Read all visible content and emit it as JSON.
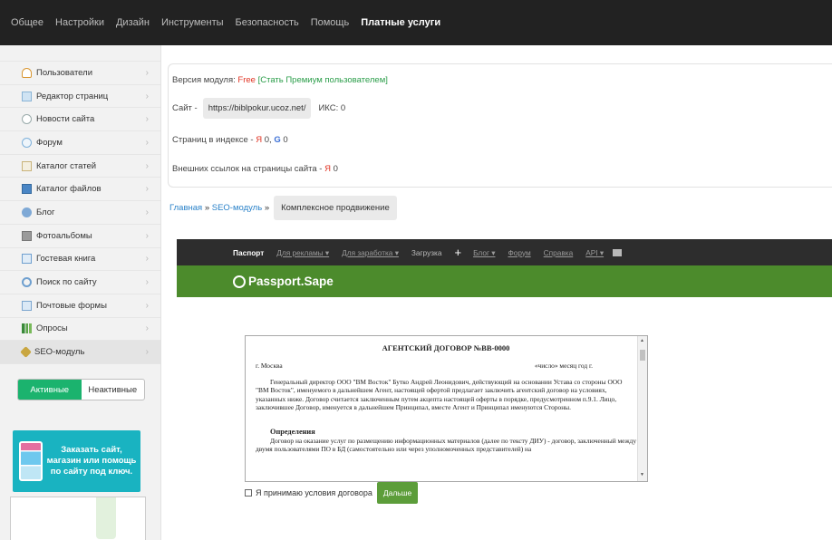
{
  "topnav": [
    {
      "label": "Общее",
      "active": false
    },
    {
      "label": "Настройки",
      "active": false
    },
    {
      "label": "Дизайн",
      "active": false
    },
    {
      "label": "Инструменты",
      "active": false
    },
    {
      "label": "Безопасность",
      "active": false
    },
    {
      "label": "Помощь",
      "active": false
    },
    {
      "label": "Платные услуги",
      "active": true
    }
  ],
  "sidebar": {
    "items": [
      {
        "label": "Пользователи",
        "icon": "user-icon"
      },
      {
        "label": "Редактор страниц",
        "icon": "page-icon"
      },
      {
        "label": "Новости сайта",
        "icon": "news-icon"
      },
      {
        "label": "Форум",
        "icon": "forum-icon"
      },
      {
        "label": "Каталог статей",
        "icon": "catalog-icon"
      },
      {
        "label": "Каталог файлов",
        "icon": "file-icon"
      },
      {
        "label": "Блог",
        "icon": "blog-icon"
      },
      {
        "label": "Фотоальбомы",
        "icon": "photo-icon"
      },
      {
        "label": "Гостевая книга",
        "icon": "guestbook-icon"
      },
      {
        "label": "Поиск по сайту",
        "icon": "search-icon"
      },
      {
        "label": "Почтовые формы",
        "icon": "mail-icon"
      },
      {
        "label": "Опросы",
        "icon": "poll-icon"
      },
      {
        "label": "SEO-модуль",
        "icon": "seo-icon"
      }
    ],
    "chevron": "›",
    "toggle": {
      "active": "Активные",
      "inactive": "Неактивные"
    },
    "promo": "Заказать сайт, магазин или помощь по сайту под ключ."
  },
  "info": {
    "version_label": "Версия модуля:",
    "version_value": "Free",
    "premium_link": "[Стать Премиум пользователем]",
    "site_label": "Сайт -",
    "site_url": "https://biblpokur.ucoz.net/",
    "iks": "ИКС: 0",
    "pages_label": "Страниц в индексе -",
    "yandex_letter": "Я",
    "yandex_pages": "0,",
    "google_letter": "G",
    "google_pages": "0",
    "links_label": "Внешних ссылок на страницы сайта -",
    "links_letter": "Я",
    "links_value": "0"
  },
  "breadcrumb": {
    "home": "Главная",
    "sep1": "»",
    "seo": "SEO-модуль",
    "sep2": "»",
    "current": "Комплексное продвижение"
  },
  "passport": {
    "nav": [
      {
        "label": "Паспорт",
        "type": "active"
      },
      {
        "label": "Для рекламы ▾",
        "type": "link"
      },
      {
        "label": "Для заработка ▾",
        "type": "link"
      },
      {
        "label": "Загрузка",
        "type": "plain"
      },
      {
        "label": "+",
        "type": "plus"
      },
      {
        "label": "Блог ▾",
        "type": "link"
      },
      {
        "label": "Форум",
        "type": "link"
      },
      {
        "label": "Справка",
        "type": "link"
      },
      {
        "label": "API ▾",
        "type": "link"
      }
    ],
    "logo": "Passport.Sape"
  },
  "document": {
    "title": "АГЕНТСКИЙ ДОГОВОР №ВВ-0000",
    "city": "г. Москва",
    "date": "«число» месяц год г.",
    "paragraph": "Генеральный директор ООО \"ВМ Восток\" Бутко Андрей Леонидович, действующий на основании Устава со стороны ООО \"ВМ Восток\", именуемого в дальнейшем Агент, настоящей офертой предлагает заключить агентский договор на условиях, указанных ниже. Договор считается заключенным путем акцепта настоящей оферты в порядке, предусмотренном п.9.1. Лицо, заключившее Договор, именуется в дальнейшем Принципал, вместе Агент и Принципал именуются Стороны.",
    "section": "Определения",
    "section_text": "Договор на оказание услуг по размещению информационных материалов (далее по тексту ДИУ) - договор, заключенный между двумя пользователями ПО в БД (самостоятельно или через уполномоченных представителей) на"
  },
  "accept": {
    "label": "Я принимаю условия договора",
    "button": "Дальше"
  }
}
